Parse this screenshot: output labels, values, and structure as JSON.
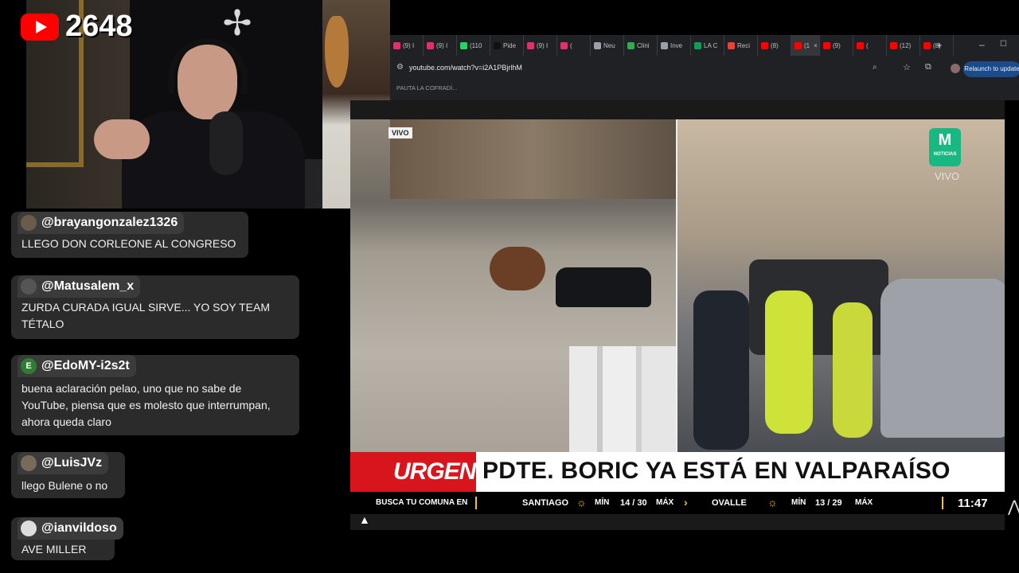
{
  "stream": {
    "viewer_count": "2648"
  },
  "chat": {
    "messages": [
      {
        "user": "@brayangonzalez1326",
        "text": "LLEGO DON CORLEONE AL CONGRESO"
      },
      {
        "user": "@Matusalem_x",
        "text": "ZURDA CURADA IGUAL SIRVE... YO SOY TEAM TÉTALO"
      },
      {
        "user": "@EdoMY-i2s2t",
        "avatar_letter": "E",
        "text": "buena aclaración pelao, uno que no sabe de YouTube, piensa que es molesto que interrumpan, ahora queda claro"
      },
      {
        "user": "@LuisJVz",
        "text": "llego Bulene o no"
      },
      {
        "user": "@ianvildoso",
        "text": "AVE MILLER"
      }
    ]
  },
  "browser": {
    "tabs": [
      {
        "label": "(9) I",
        "color": "#e1306c"
      },
      {
        "label": "(9) I",
        "color": "#e1306c"
      },
      {
        "label": "(110",
        "color": "#25d366"
      },
      {
        "label": "Pide",
        "color": "#111111"
      },
      {
        "label": "(9) I",
        "color": "#e1306c"
      },
      {
        "label": "(",
        "color": "#e1306c"
      },
      {
        "label": "Neu",
        "color": "#9aa0a6"
      },
      {
        "label": "Clini",
        "color": "#34a853"
      },
      {
        "label": "Inve",
        "color": "#9aa0a6"
      },
      {
        "label": "LA C",
        "color": "#0f9d58"
      },
      {
        "label": "Reci",
        "color": "#ea4335"
      },
      {
        "label": "(8)",
        "color": "#ff0000"
      },
      {
        "label": "(1",
        "color": "#ff0000",
        "active": true
      },
      {
        "label": "(9)",
        "color": "#ff0000"
      },
      {
        "label": "(",
        "color": "#ff0000"
      },
      {
        "label": "(12)",
        "color": "#ff0000"
      },
      {
        "label": "(8)",
        "color": "#ff0000"
      }
    ],
    "url": "youtube.com/watch?v=i2A1PBjrlhM",
    "relaunch_label": "Relaunch to update",
    "bookmark": "PAUTA LA COFRADÍ..."
  },
  "video": {
    "live_label_left": "VIVO",
    "channel_logo_label": "NOTICIAS",
    "live_label_right": "VIVO",
    "urgent_label": "URGENTE",
    "headline": "PDTE. BORIC YA ESTÁ EN VALPARAÍSO",
    "ticker": {
      "search_prompt": "BUSCA TU COMUNA EN",
      "city1": "SANTIAGO",
      "min_label": "MÍN",
      "city1_temps": "14 / 30",
      "max_label": "MÁX",
      "city2": "OVALLE",
      "city2_temps": "13 / 29",
      "time": "11:47"
    }
  },
  "colors": {
    "urgent_red": "#d8141c",
    "ticker_yellow": "#f5c518",
    "logo_green": "#19b882"
  }
}
